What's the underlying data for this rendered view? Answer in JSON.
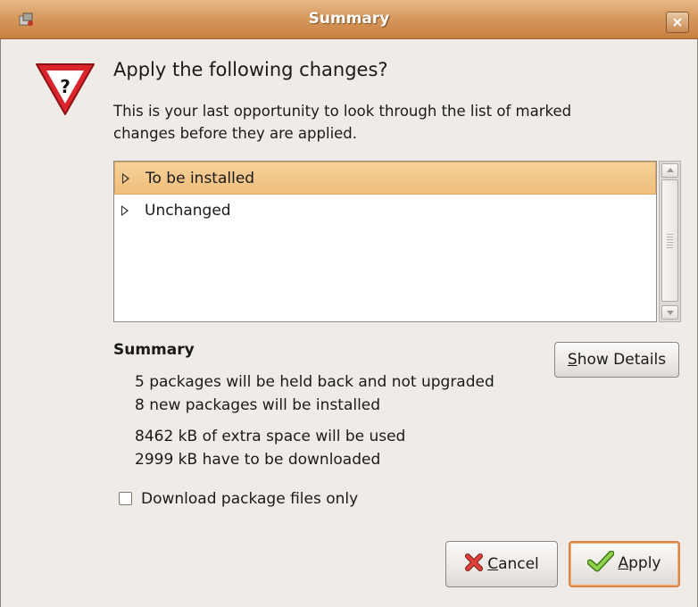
{
  "window": {
    "title": "Summary",
    "close_label": "×"
  },
  "dialog": {
    "heading": "Apply the following changes?",
    "description": "This is your last opportunity to look through the list of marked changes before they are applied."
  },
  "changes_tree": {
    "rows": [
      {
        "label": "To be installed",
        "selected": true
      },
      {
        "label": "Unchanged",
        "selected": false
      }
    ]
  },
  "summary": {
    "title": "Summary",
    "lines": [
      "5 packages will be held back and not upgraded",
      "8 new packages will be installed",
      "8462 kB of extra space will be used",
      "2999 kB have to be downloaded"
    ],
    "show_details": {
      "mnemonic": "S",
      "rest": "how Details"
    }
  },
  "options": {
    "download_only": {
      "label": "Download package files only",
      "checked": false
    }
  },
  "buttons": {
    "cancel": {
      "mnemonic": "C",
      "rest": "ancel"
    },
    "apply": {
      "mnemonic": "A",
      "rest": "pply"
    }
  },
  "colors": {
    "titlebar": "#d79a5f",
    "selection": "#f3c88c",
    "warning_red": "#d9252b",
    "default_button_border": "#d9854a"
  },
  "icons": {
    "app": "package-manager-icon",
    "warning": "question-warning-icon",
    "cancel": "cancel-x-icon",
    "apply": "checkmark-icon"
  }
}
